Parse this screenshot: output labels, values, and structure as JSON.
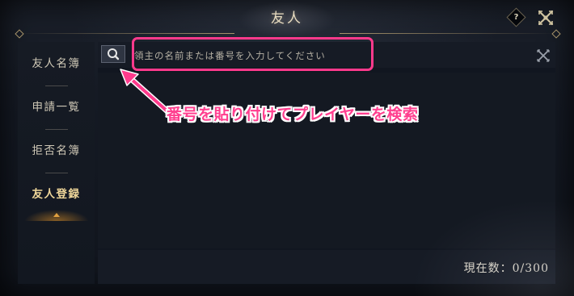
{
  "header": {
    "title": "友人",
    "help_label": "?"
  },
  "sidebar": {
    "items": [
      {
        "label": "友人名簿",
        "active": false
      },
      {
        "label": "申請一覧",
        "active": false
      },
      {
        "label": "拒否名簿",
        "active": false
      },
      {
        "label": "友人登録",
        "active": true
      }
    ]
  },
  "search": {
    "placeholder": "領主の名前または番号を入力してください",
    "value": ""
  },
  "footer": {
    "count_label": "現在数：",
    "count_value": "0/300"
  },
  "annotation": {
    "text": "番号を貼り付けてプレイヤーを検索",
    "color": "#ff3a8c"
  },
  "colors": {
    "active_tab": "#f0d79a",
    "accent_gold": "#a8946a"
  },
  "icons": {
    "help": "help-icon",
    "close": "close-icon",
    "search": "search-icon",
    "clear": "clear-icon",
    "arrow": "arrow-icon"
  }
}
